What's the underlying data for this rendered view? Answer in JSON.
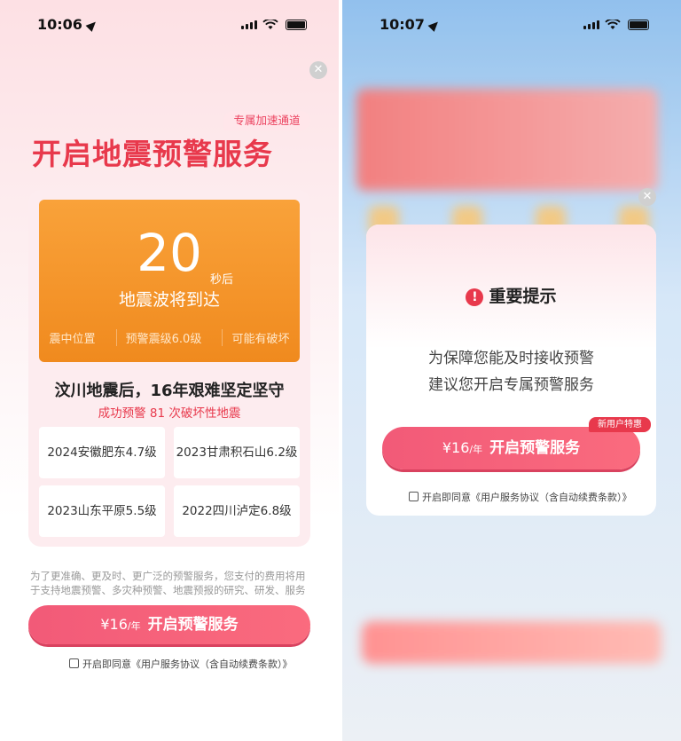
{
  "left": {
    "status": {
      "time": "10:06"
    },
    "badge": "专属加速通道",
    "title": "开启地震预警服务",
    "countdown": {
      "number": "20",
      "unit": "秒后",
      "text": "地震波将到达",
      "meta": [
        "震中位置",
        "预警震级6.0级",
        "可能有破坏"
      ]
    },
    "headline": "汶川地震后，16年艰难坚定坚守",
    "subline": "成功预警 81 次破坏性地震",
    "quakes": [
      "2024安徽肥东4.7级",
      "2023甘肃积石山6.2级",
      "2023山东平原5.5级",
      "2022四川泸定6.8级"
    ],
    "footnote": "为了更准确、更及时、更广泛的预警服务，您支付的费用将用于支持地震预警、多灾种预警、地震预报的研究、研发、服务",
    "cta": {
      "price": "¥16",
      "per": "/年",
      "label": "开启预警服务"
    },
    "agreement": "开启即同意《用户服务协议（含自动续费条款）》"
  },
  "right": {
    "status": {
      "time": "10:07"
    },
    "modal": {
      "title": "重要提示",
      "body_line1": "为保障您能及时接收预警",
      "body_line2": "建议您开启专属预警服务",
      "new_user_badge": "新用户特惠",
      "cta": {
        "price": "¥16",
        "per": "/年",
        "label": "开启预警服务"
      },
      "agreement": "开启即同意《用户服务协议（含自动续费条款）》"
    }
  },
  "colors": {
    "accent": "#e8394c",
    "cta": "#f25a78",
    "countdown": "#f39a2e"
  },
  "icons": [
    "location-arrow-icon",
    "signal-icon",
    "wifi-icon",
    "battery-icon",
    "close-icon",
    "warning-icon",
    "checkbox-icon"
  ]
}
